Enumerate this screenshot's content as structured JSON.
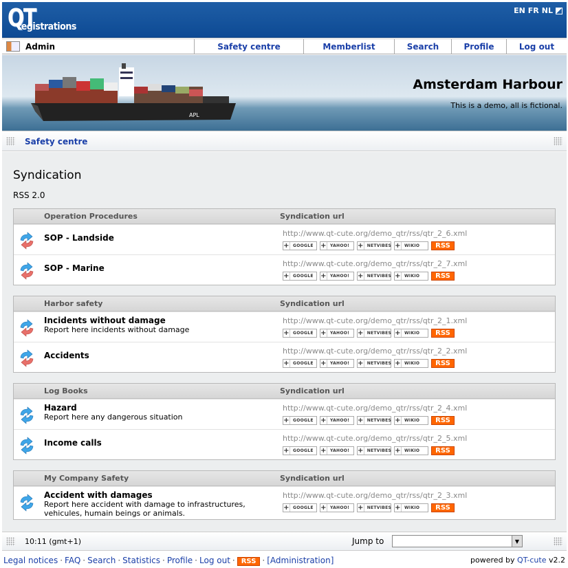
{
  "header": {
    "logo_main": "QT",
    "logo_sub": "registrations",
    "languages": [
      "EN",
      "FR",
      "NL"
    ]
  },
  "menu": {
    "user": "Admin",
    "items": [
      "Safety centre",
      "Memberlist",
      "Search",
      "Profile",
      "Log out"
    ]
  },
  "banner": {
    "title": "Amsterdam Harbour",
    "subtitle": "This is a demo, all is fictional."
  },
  "breadcrumb": "Safety centre",
  "page": {
    "title": "Syndication",
    "format": "RSS 2.0"
  },
  "button_labels": {
    "google": "GOOGLE",
    "yahoo": "YAHOO!",
    "netvibes": "NETVIBES",
    "wikio": "WIKIO",
    "rss": "RSS"
  },
  "sections": [
    {
      "name": "Operation Procedures",
      "col2": "Syndication url",
      "rows": [
        {
          "title": "SOP - Landside",
          "desc": "",
          "url": "http://www.qt-cute.org/demo_qtr/rss/qtr_2_6.xml",
          "icon": "sync-red-icon"
        },
        {
          "title": "SOP - Marine",
          "desc": "",
          "url": "http://www.qt-cute.org/demo_qtr/rss/qtr_2_7.xml",
          "icon": "sync-red-icon"
        }
      ]
    },
    {
      "name": "Harbor safety",
      "col2": "Syndication url",
      "rows": [
        {
          "title": "Incidents without damage",
          "desc": "Report here incidents without damage",
          "url": "http://www.qt-cute.org/demo_qtr/rss/qtr_2_1.xml",
          "icon": "sync-red-icon"
        },
        {
          "title": "Accidents",
          "desc": "",
          "url": "http://www.qt-cute.org/demo_qtr/rss/qtr_2_2.xml",
          "icon": "sync-red-icon"
        }
      ]
    },
    {
      "name": "Log Books",
      "col2": "Syndication url",
      "rows": [
        {
          "title": "Hazard",
          "desc": "Report here any dangerous situation",
          "url": "http://www.qt-cute.org/demo_qtr/rss/qtr_2_4.xml",
          "icon": "sync-blue-icon"
        },
        {
          "title": "Income calls",
          "desc": "",
          "url": "http://www.qt-cute.org/demo_qtr/rss/qtr_2_5.xml",
          "icon": "sync-blue-icon"
        }
      ]
    },
    {
      "name": "My Company Safety",
      "col2": "Syndication url",
      "rows": [
        {
          "title": "Accident with damages",
          "desc": "Report here accident with damage to infrastructures, vehicules, humain beings or animals.",
          "url": "http://www.qt-cute.org/demo_qtr/rss/qtr_2_3.xml",
          "icon": "sync-blue-icon"
        }
      ]
    }
  ],
  "footer": {
    "time": "10:11 (gmt+1)",
    "jump_label": "Jump to",
    "jump_value": ""
  },
  "bottom_links": [
    "Legal notices",
    "FAQ",
    "Search",
    "Statistics",
    "Profile",
    "Log out"
  ],
  "bottom_rss": "RSS",
  "bottom_admin": "[Administration]",
  "powered": {
    "prefix": "powered by",
    "link": "QT-cute",
    "version": "v2.2"
  },
  "colors": {
    "header_blue": "#0d4a94",
    "link_blue": "#1a3fa8",
    "rss_orange": "#ff6600"
  }
}
